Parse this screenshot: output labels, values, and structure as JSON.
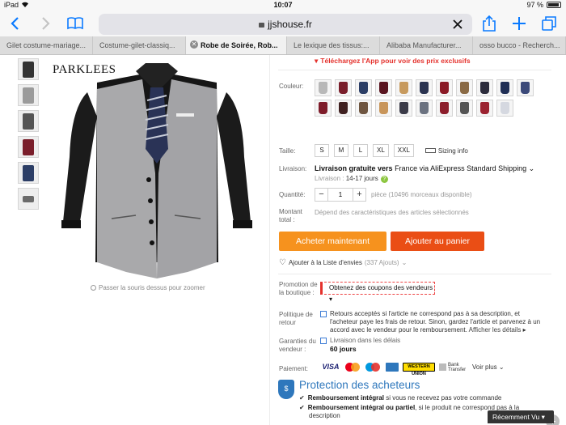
{
  "status": {
    "device": "iPad",
    "time": "10:07",
    "battery": "97 %"
  },
  "browser": {
    "url": "jjshouse.fr",
    "tabs": [
      {
        "label": "Gilet costume-mariage..."
      },
      {
        "label": "Costume-gilet-classiq..."
      },
      {
        "label": "Robe de Soirée, Rob..."
      },
      {
        "label": "Le lexique des tissus:..."
      },
      {
        "label": "Alibaba Manufacturer..."
      },
      {
        "label": "osso bucco - Recherch..."
      }
    ]
  },
  "gallery": {
    "brand": "PARKLEES",
    "zoom_hint": "Passer la souris dessus pour zoomer"
  },
  "product": {
    "app_promo": "Téléchargez l'App pour voir des prix exclusifs",
    "color_label": "Couleur:",
    "colors": [
      "#b8b8b8",
      "#7a1e2b",
      "#2c3e66",
      "#5a1520",
      "#c79a5e",
      "#2a3350",
      "#8b1a26",
      "#8a6a45",
      "#2c2c3c",
      "#1f2e55",
      "#3c4a7a",
      "#7e1c2a",
      "#3f2020",
      "#6e5540",
      "#c8955a",
      "#3b3b48",
      "#6b7280",
      "#8c1d2b",
      "#555",
      "#9b2230",
      "#d5d8e0"
    ],
    "size_label": "Taille:",
    "sizes": [
      "S",
      "M",
      "L",
      "XL",
      "XXL"
    ],
    "size_info": "Sizing info",
    "shipping_label": "Livraison:",
    "shipping_pre": "Livraison gratuite vers",
    "shipping_dest": "France via AliExpress Standard Shipping",
    "delivery_label": "Livraison :",
    "delivery_days": "14-17 jours",
    "qty_label": "Quantité:",
    "qty_value": "1",
    "qty_note": "pièce (10496 morceaux disponible)",
    "total_label": "Montant total :",
    "total_note": "Dépend des caractéristiques des articles sélectionnés",
    "buy_now": "Acheter maintenant",
    "add_cart": "Ajouter au panier",
    "wishlist": "Ajouter à la Liste d'envies",
    "wishlist_count": "(337 Ajouts)",
    "promo_label": "Promotion de la boutique :",
    "coupon": "Obtenez des coupons des vendeurs",
    "return_label": "Politique de retour",
    "return_text": "Retours acceptés si l'article ne correspond pas à sa description, et l'acheteur paye les frais de retour. Sinon, gardez l'article et parvenez à un accord avec le vendeur pour le remboursement.",
    "return_link": "Afficher les détails",
    "guarantee_label": "Garanties du vendeur :",
    "guarantee_text": "Livraison dans les délais",
    "guarantee_days": "60 jours",
    "payment_label": "Paiement:",
    "payment_more": "Voir plus",
    "payment_visa": "VISA",
    "payment_wu": "WESTERN UNION",
    "payment_bank": "Bank Transfer",
    "protection_title": "Protection des acheteurs",
    "protection_1_bold": "Remboursement intégral",
    "protection_1_rest": "si vous ne recevez pas votre commande",
    "protection_2_bold": "Remboursement intégral ou partiel",
    "protection_2_rest": ", si le produit ne correspond pas à la",
    "protection_2_cont": "description"
  },
  "widgets": {
    "recent": "Récemment Vu"
  }
}
